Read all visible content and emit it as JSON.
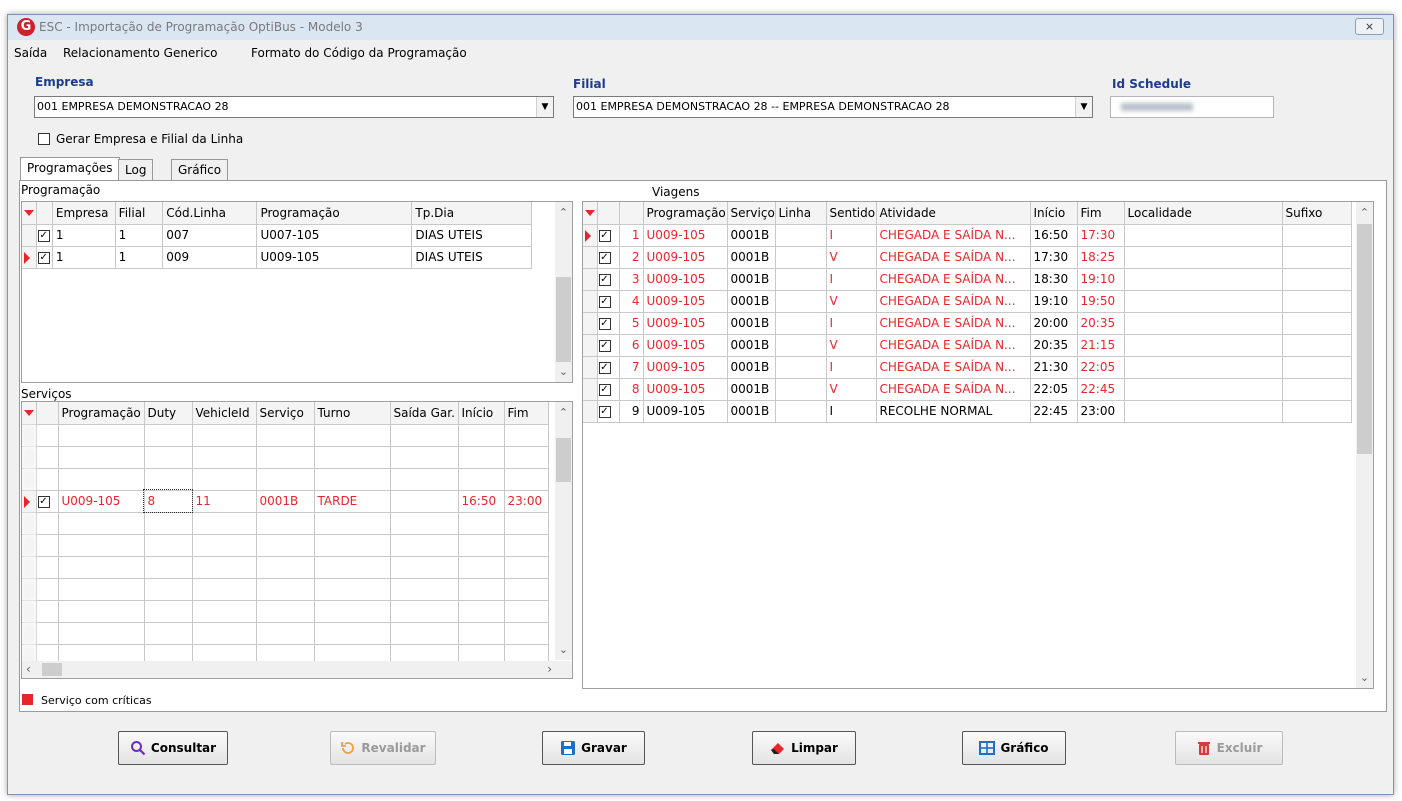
{
  "window": {
    "title": "ESC - Importação de Programação OptiBus - Modelo 3",
    "logo": "G",
    "close": "⨯"
  },
  "menu": [
    "Saída",
    "Relacionamento Generico",
    "Formato do Código da Programação"
  ],
  "empresa": {
    "label": "Empresa",
    "value": "001 EMPRESA DEMONSTRACAO 28"
  },
  "filial": {
    "label": "Filial",
    "value": "001 EMPRESA DEMONSTRACAO 28 -- EMPRESA DEMONSTRACAO 28"
  },
  "id_schedule": {
    "label": "Id Schedule"
  },
  "gerar": {
    "label": "Gerar Empresa e Filial da Linha",
    "checked": false
  },
  "tabs": [
    "Programações",
    "Log",
    "Gráfico"
  ],
  "programacao": {
    "label": "Programação",
    "columns": [
      "Empresa",
      "Filial",
      "Cód.Linha",
      "Programação",
      "Tp.Dia"
    ],
    "rows": [
      [
        "1",
        "1",
        "007",
        "U007-105",
        "DIAS UTEIS"
      ],
      [
        "1",
        "1",
        "009",
        "U009-105",
        "DIAS UTEIS"
      ]
    ]
  },
  "servicos": {
    "label": "Serviços",
    "columns": [
      "Programação",
      "Duty",
      "VehicleId",
      "Serviço",
      "Turno",
      "Saída Gar.",
      "Início",
      "Fim"
    ],
    "selected": [
      "U009-105",
      "8",
      "11",
      "0001B",
      "TARDE",
      "",
      "16:50",
      "23:00"
    ],
    "blurred_rows_before": 3,
    "blurred_rows_after": 7
  },
  "viagens": {
    "label": "Viagens",
    "columns": [
      "Programação",
      "Serviço",
      "Linha",
      "Sentido",
      "Atividade",
      "Início",
      "Fim",
      "Localidade",
      "Sufixo"
    ],
    "rows": [
      [
        "1",
        "U009-105",
        "0001B",
        "",
        "I",
        "CHEGADA E SAÍDA N...",
        "16:50",
        "17:30",
        "",
        ""
      ],
      [
        "2",
        "U009-105",
        "0001B",
        "",
        "V",
        "CHEGADA E SAÍDA N...",
        "17:30",
        "18:25",
        "",
        ""
      ],
      [
        "3",
        "U009-105",
        "0001B",
        "",
        "I",
        "CHEGADA E SAÍDA N...",
        "18:30",
        "19:10",
        "",
        ""
      ],
      [
        "4",
        "U009-105",
        "0001B",
        "",
        "V",
        "CHEGADA E SAÍDA N...",
        "19:10",
        "19:50",
        "",
        ""
      ],
      [
        "5",
        "U009-105",
        "0001B",
        "",
        "I",
        "CHEGADA E SAÍDA N...",
        "20:00",
        "20:35",
        "",
        ""
      ],
      [
        "6",
        "U009-105",
        "0001B",
        "",
        "V",
        "CHEGADA E SAÍDA N...",
        "20:35",
        "21:15",
        "",
        ""
      ],
      [
        "7",
        "U009-105",
        "0001B",
        "",
        "I",
        "CHEGADA E SAÍDA N...",
        "21:30",
        "22:05",
        "",
        ""
      ],
      [
        "8",
        "U009-105",
        "0001B",
        "",
        "V",
        "CHEGADA E SAÍDA N...",
        "22:05",
        "22:45",
        "",
        ""
      ],
      [
        "9",
        "U009-105",
        "0001B",
        "",
        "I",
        "RECOLHE NORMAL",
        "22:45",
        "23:00",
        "",
        ""
      ]
    ]
  },
  "legend": {
    "label": "Serviço com críticas",
    "color": "#e8262a"
  },
  "buttons": [
    {
      "key": "consultar",
      "label": "Consultar",
      "enabled": true,
      "icon": "search-icon"
    },
    {
      "key": "revalidar",
      "label": "Revalidar",
      "enabled": false,
      "icon": "refresh-icon"
    },
    {
      "key": "gravar",
      "label": "Gravar",
      "enabled": true,
      "icon": "save-icon"
    },
    {
      "key": "limpar",
      "label": "Limpar",
      "enabled": true,
      "icon": "eraser-icon"
    },
    {
      "key": "grafico",
      "label": "Gráfico",
      "enabled": true,
      "icon": "table-icon"
    },
    {
      "key": "excluir",
      "label": "Excluir",
      "enabled": false,
      "icon": "trash-icon"
    }
  ],
  "colors": {
    "critical": "#e8262a",
    "label_blue": "#1c3d8c",
    "accent_blue": "#1e6fc9"
  }
}
